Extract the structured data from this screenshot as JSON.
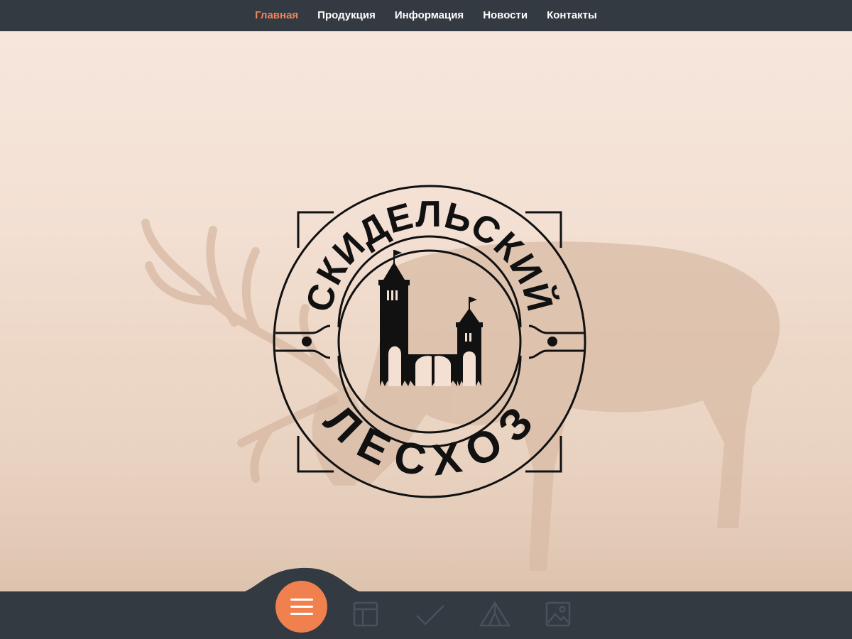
{
  "nav": {
    "items": [
      {
        "label": "Главная",
        "active": true
      },
      {
        "label": "Продукция",
        "active": false
      },
      {
        "label": "Информация",
        "active": false
      },
      {
        "label": "Новости",
        "active": false
      },
      {
        "label": "Контакты",
        "active": false
      }
    ]
  },
  "logo": {
    "top_text": "СКИДЕЛЬСКИЙ",
    "bottom_text": "ЛЕСХОЗ"
  },
  "bottom_bar": {
    "icons": [
      "menu-icon",
      "layout-icon",
      "check-icon",
      "tent-icon",
      "image-icon"
    ]
  },
  "colors": {
    "nav_bg": "#343a42",
    "accent": "#f0845a",
    "hero_tint": "#f3e0d3",
    "icon_muted": "#4a515a"
  }
}
